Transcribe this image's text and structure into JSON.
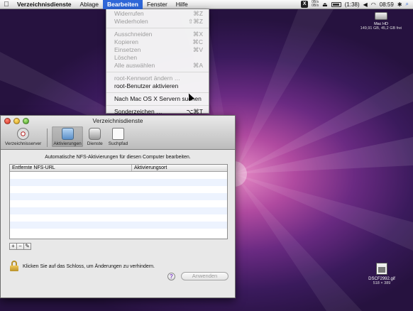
{
  "menubar": {
    "app": "Verzeichnisdienste",
    "items": [
      "Ablage",
      "Bearbeiten",
      "Fenster",
      "Hilfe"
    ],
    "active_index": 1,
    "clock": "08:59",
    "battery": "(1:38)",
    "net_rate_up": "0B/s",
    "net_rate_down": "0B/s"
  },
  "edit_menu": {
    "items": [
      {
        "label": "Widerrufen",
        "shortcut": "⌘Z",
        "enabled": false
      },
      {
        "label": "Wiederholen",
        "shortcut": "⇧⌘Z",
        "enabled": false
      },
      {
        "sep": true
      },
      {
        "label": "Ausschneiden",
        "shortcut": "⌘X",
        "enabled": false
      },
      {
        "label": "Kopieren",
        "shortcut": "⌘C",
        "enabled": false
      },
      {
        "label": "Einsetzen",
        "shortcut": "⌘V",
        "enabled": false
      },
      {
        "label": "Löschen",
        "shortcut": "",
        "enabled": false
      },
      {
        "label": "Alle auswählen",
        "shortcut": "⌘A",
        "enabled": false
      },
      {
        "sep": true
      },
      {
        "label": "root-Kennwort ändern …",
        "shortcut": "",
        "enabled": false
      },
      {
        "label": "root-Benutzer aktivieren",
        "shortcut": "",
        "enabled": true
      },
      {
        "sep": true
      },
      {
        "label": "Nach Mac OS X Servern suchen",
        "shortcut": "",
        "enabled": true
      },
      {
        "sep": true
      },
      {
        "label": "Sonderzeichen …",
        "shortcut": "⌥⌘T",
        "enabled": true
      }
    ]
  },
  "desktop": {
    "hd_name": "Mac HD",
    "hd_info": "149,91 GB, 45,2 GB frei",
    "file_name": "DSCF2992.gif",
    "file_info": "518 × 389"
  },
  "window": {
    "title": "Verzeichnisdienste",
    "toolbar": [
      {
        "label": "Verzeichnisserver",
        "icon": "directory-server-icon",
        "selected": false
      },
      {
        "label": "Aktivierungen",
        "icon": "activations-icon",
        "selected": true
      },
      {
        "label": "Dienste",
        "icon": "services-icon",
        "selected": false
      },
      {
        "label": "Suchpfad",
        "icon": "search-path-icon",
        "selected": false
      }
    ],
    "description": "Automatische NFS-Aktivierungen für diesen Computer bearbeiten.",
    "table": {
      "columns": [
        "Entfernte NFS-URL",
        "Aktivierungsort"
      ],
      "rows": []
    },
    "buttons": {
      "add": "+",
      "remove": "−",
      "edit": "✎"
    },
    "lock_text": "Klicken Sie auf das Schloss, um Änderungen zu verhindern.",
    "help": "?",
    "apply": "Anwenden"
  }
}
